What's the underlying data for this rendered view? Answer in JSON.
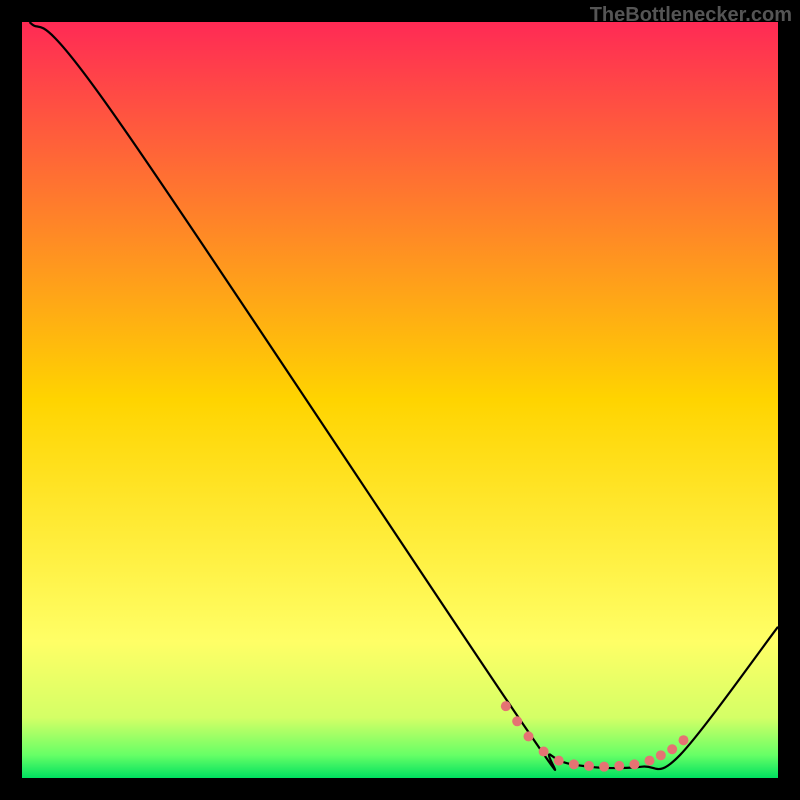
{
  "watermark": "TheBottlenecker.com",
  "chart_data": {
    "type": "line",
    "title": "",
    "xlabel": "",
    "ylabel": "",
    "xlim": [
      0,
      100
    ],
    "ylim": [
      0,
      100
    ],
    "gradient": {
      "stops": [
        {
          "offset": 0,
          "color": "#ff2a55"
        },
        {
          "offset": 50,
          "color": "#ffd400"
        },
        {
          "offset": 82,
          "color": "#ffff66"
        },
        {
          "offset": 92,
          "color": "#d4ff66"
        },
        {
          "offset": 97,
          "color": "#66ff66"
        },
        {
          "offset": 100,
          "color": "#00e060"
        }
      ]
    },
    "series": [
      {
        "name": "curve",
        "points": [
          {
            "x": 1,
            "y": 100
          },
          {
            "x": 12,
            "y": 88
          },
          {
            "x": 65,
            "y": 9
          },
          {
            "x": 70,
            "y": 3
          },
          {
            "x": 75,
            "y": 1.5
          },
          {
            "x": 82,
            "y": 1.5
          },
          {
            "x": 87,
            "y": 3
          },
          {
            "x": 100,
            "y": 20
          }
        ]
      }
    ],
    "valley_dots": [
      {
        "x": 64,
        "y": 9.5
      },
      {
        "x": 65.5,
        "y": 7.5
      },
      {
        "x": 67,
        "y": 5.5
      },
      {
        "x": 69,
        "y": 3.5
      },
      {
        "x": 71,
        "y": 2.3
      },
      {
        "x": 73,
        "y": 1.8
      },
      {
        "x": 75,
        "y": 1.6
      },
      {
        "x": 77,
        "y": 1.5
      },
      {
        "x": 79,
        "y": 1.6
      },
      {
        "x": 81,
        "y": 1.8
      },
      {
        "x": 83,
        "y": 2.3
      },
      {
        "x": 84.5,
        "y": 3
      },
      {
        "x": 86,
        "y": 3.8
      },
      {
        "x": 87.5,
        "y": 5
      }
    ],
    "dot_color": "#e57373",
    "dot_radius": 5
  }
}
